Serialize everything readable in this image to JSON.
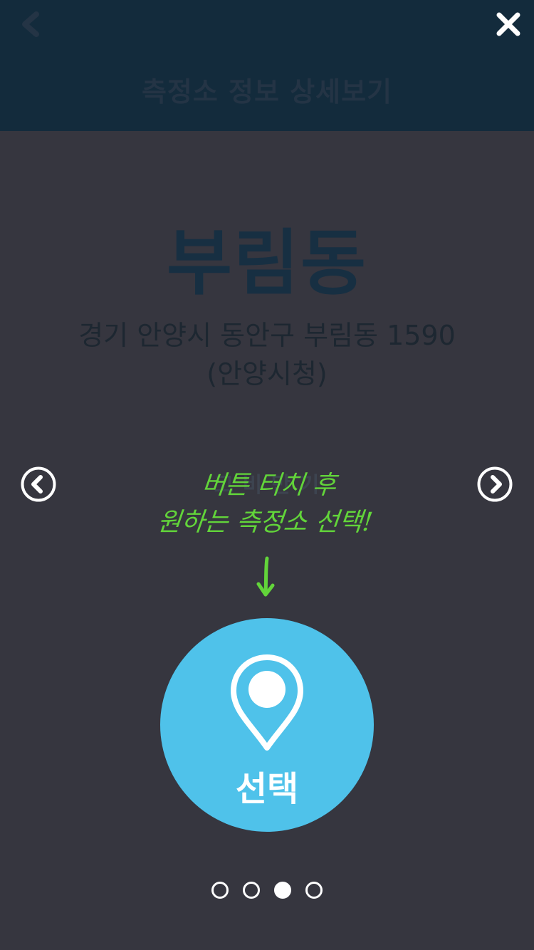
{
  "header": {
    "title": "측정소 정보 상세보기",
    "back_icon": "chevron-left-icon",
    "close_icon": "close-icon"
  },
  "station": {
    "name": "부림동",
    "address_line1": "경기 안양시 동안구 부림동 1590",
    "address_line2": "(안양시청)"
  },
  "carousel": {
    "prev_icon": "circle-chevron-left-icon",
    "next_icon": "circle-chevron-right-icon",
    "ghost_label": "고 비 만 기",
    "hint_line1": "버튼 터치 후",
    "hint_line2": "원하는 측정소 선택!",
    "page_count": 4,
    "active_page": 3
  },
  "select_button": {
    "label": "선택",
    "icon": "location-pin-icon"
  },
  "colors": {
    "background": "#36363f",
    "header_bg": "#132b3c",
    "accent": "#4fc2ea",
    "hint_green": "#62d43a"
  }
}
